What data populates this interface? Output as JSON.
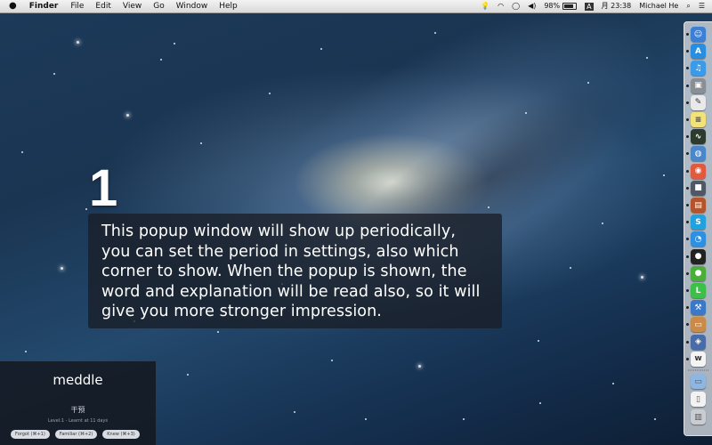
{
  "menubar": {
    "apple": "",
    "app_name": "Finder",
    "items": [
      "File",
      "Edit",
      "View",
      "Go",
      "Window",
      "Help"
    ],
    "status": {
      "battery_percent": "98%",
      "input_method": "A",
      "clock": "月 23:38",
      "user": "Michael He"
    }
  },
  "step": {
    "number": "1"
  },
  "instruction": {
    "text": "This popup window will show up periodically, you can set the period in settings, also which corner to show. When the popup is shown, the word and explanation will be read also, so it will give you more stronger impression."
  },
  "word_popup": {
    "word": "meddle",
    "meaning": "干预",
    "level_info": "Level:1 - Learnt at 11 days",
    "buttons": [
      "Forgot (⌘+1)",
      "Familiar (⌘+2)",
      "Knew (⌘+3)"
    ]
  },
  "dock": {
    "icons": [
      {
        "name": "finder-icon",
        "color": "#3b7fd6",
        "glyph": "☺"
      },
      {
        "name": "app-store-icon",
        "color": "#2a8ee0",
        "glyph": "A"
      },
      {
        "name": "itunes-icon",
        "color": "#3c9be8",
        "glyph": "♫"
      },
      {
        "name": "preview-icon",
        "color": "#8a8f96",
        "glyph": "▣"
      },
      {
        "name": "textedit-icon",
        "color": "#e9e9e9",
        "glyph": "✎"
      },
      {
        "name": "stickies-icon",
        "color": "#f3e27a",
        "glyph": "≡"
      },
      {
        "name": "activity-monitor-icon",
        "color": "#2d3a2e",
        "glyph": "∿"
      },
      {
        "name": "network-utility-icon",
        "color": "#4a86c8",
        "glyph": "◍"
      },
      {
        "name": "chrome-icon",
        "color": "#e05a3f",
        "glyph": "◉"
      },
      {
        "name": "facetime-icon",
        "color": "#505865",
        "glyph": "■"
      },
      {
        "name": "photo-booth-icon",
        "color": "#b5542b",
        "glyph": "▤"
      },
      {
        "name": "skype-icon",
        "color": "#1fa2e0",
        "glyph": "S"
      },
      {
        "name": "messages-icon",
        "color": "#2f8fe0",
        "glyph": "◔"
      },
      {
        "name": "qq-icon",
        "color": "#222222",
        "glyph": "●"
      },
      {
        "name": "wechat-icon",
        "color": "#4cae3a",
        "glyph": "●"
      },
      {
        "name": "line-icon",
        "color": "#3cc04a",
        "glyph": "L"
      },
      {
        "name": "xcode-icon",
        "color": "#3b78c8",
        "glyph": "⚒"
      },
      {
        "name": "archive-icon",
        "color": "#c98a4a",
        "glyph": "▭"
      },
      {
        "name": "virtualbox-icon",
        "color": "#4a6ca6",
        "glyph": "◈"
      },
      {
        "name": "word-app-icon",
        "color": "#f4f4f4",
        "glyph": "w"
      }
    ],
    "stack_icons": [
      {
        "name": "downloads-folder-icon",
        "color": "#8fb6e0",
        "glyph": "▭"
      },
      {
        "name": "document-icon",
        "color": "#f2f2f2",
        "glyph": "▯"
      },
      {
        "name": "trash-icon",
        "color": "#c9ccd1",
        "glyph": "▥"
      }
    ]
  }
}
